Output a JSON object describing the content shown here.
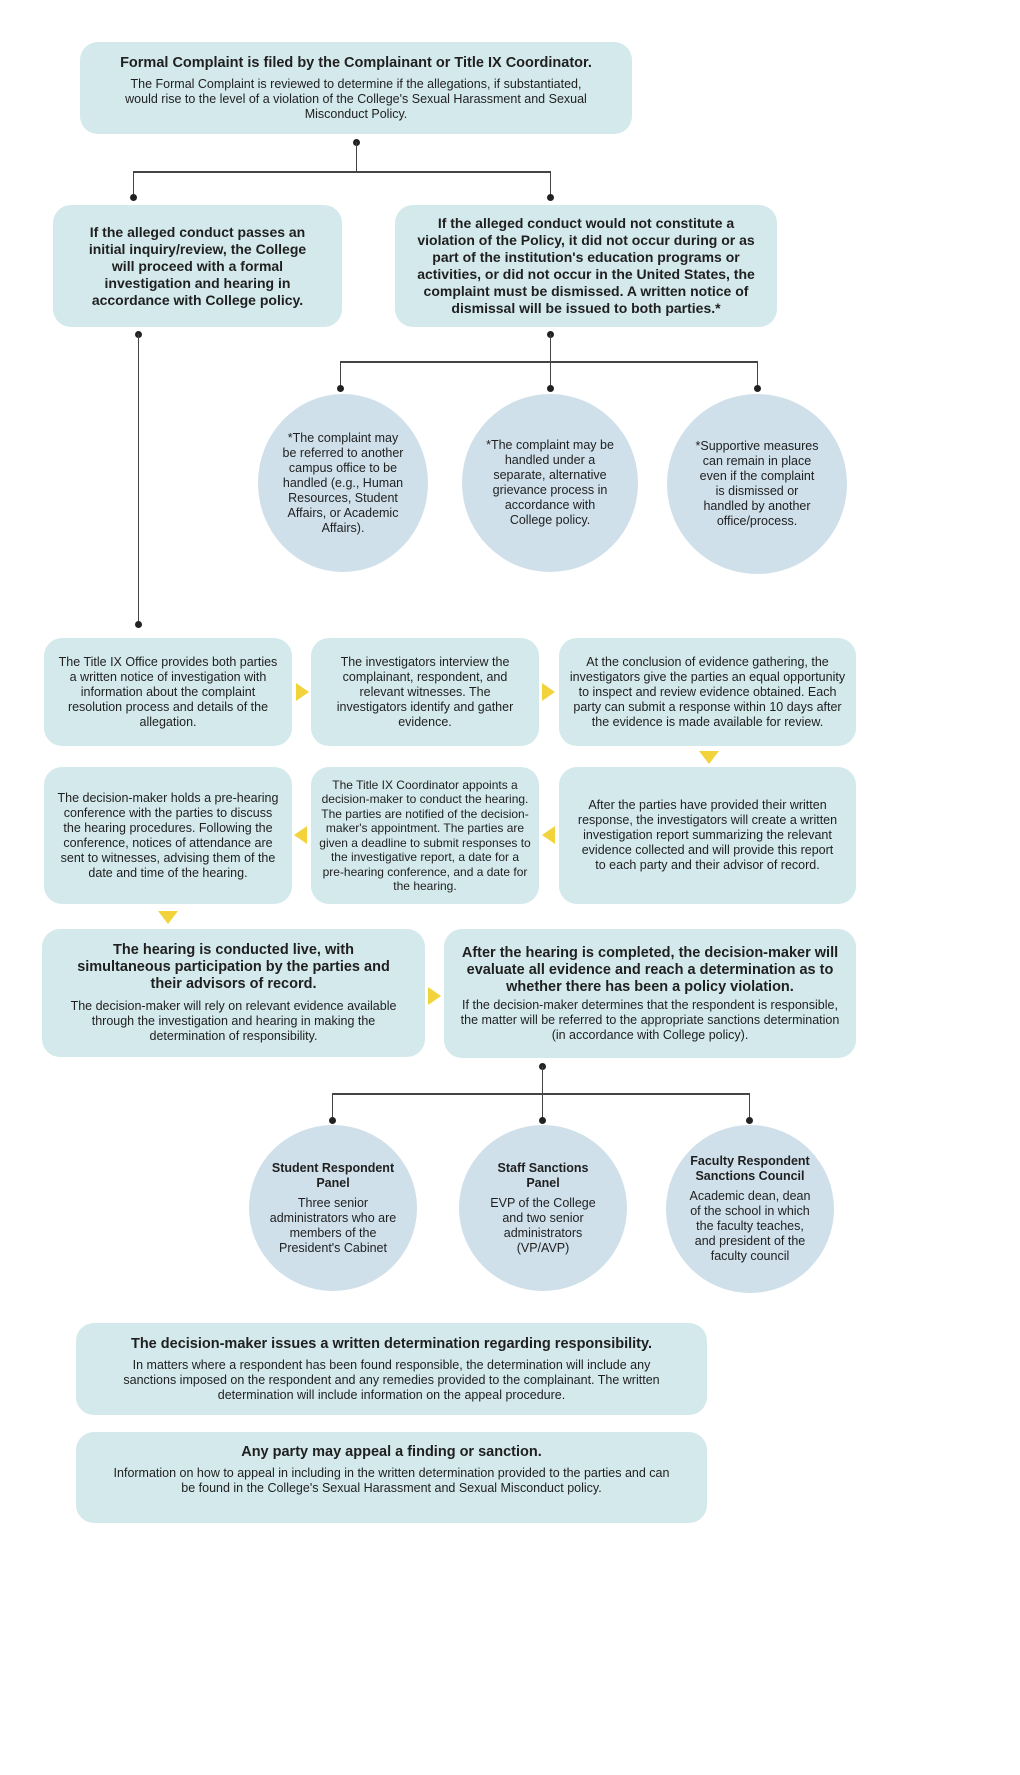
{
  "colors": {
    "box_fill": "#d4e9ec",
    "circle_fill": "#cfe0ea",
    "arrow": "#f2d33c",
    "connector": "#444444"
  },
  "formal_complaint": {
    "title": "Formal Complaint is filed by the Complainant or Title IX Coordinator.",
    "body": "The Formal Complaint is reviewed to determine if the allegations, if substantiated, would rise to the level of a violation of the College's Sexual Harassment and Sexual Misconduct Policy."
  },
  "branch_proceed": {
    "text": "If the alleged conduct passes an initial inquiry/review, the College will proceed with a formal investigation and hearing in accordance with College policy."
  },
  "branch_dismiss": {
    "text": "If the alleged conduct would not constitute a violation of the Policy, it did not occur during or as part of the institution's education programs or activities, or did not occur in the United States, the complaint must be dismissed. A written notice of dismissal will be issued to both parties.*"
  },
  "dismissal_notes": [
    {
      "text": "*The complaint may be referred to another campus office to be handled (e.g., Human Resources, Student Affairs, or Academic Affairs)."
    },
    {
      "text": "*The complaint may be handled under a separate, alternative grievance process in accordance with College policy."
    },
    {
      "text": "*Supportive measures can remain in place even if the complaint is dismissed or handled by another office/process."
    }
  ],
  "process_steps": [
    {
      "text": "The Title IX Office provides both parties a written notice of investigation with information about the complaint resolution process and details of the allegation."
    },
    {
      "text": "The investigators interview the complainant, respondent, and relevant witnesses. The investigators identify and gather evidence."
    },
    {
      "text": "At the conclusion of evidence gathering, the investigators give the parties an equal opportunity to inspect and review evidence obtained. Each party can submit a response within 10 days after the evidence is made available for review."
    },
    {
      "text": "After the parties have provided their written response, the investigators will create a written investigation report summarizing the relevant evidence collected and will provide this report to each party and their advisor of record."
    },
    {
      "text": "The Title IX Coordinator appoints a decision-maker to conduct the hearing. The parties are notified of the decision-maker's appointment. The parties are given a deadline to submit responses to the investigative report, a date for a pre-hearing conference, and a date for the hearing."
    },
    {
      "text": "The decision-maker holds a pre-hearing conference with the parties to discuss the hearing procedures. Following the conference, notices of attendance are sent to witnesses, advising them of the date and time of the hearing."
    }
  ],
  "hearing": {
    "title": "The hearing is conducted live, with simultaneous participation by the parties and their advisors of record.",
    "body": "The decision-maker will rely on relevant evidence available through the investigation and hearing in making the determination of responsibility."
  },
  "after_hearing": {
    "title": "After the hearing is completed, the decision-maker will evaluate all evidence and reach a determination as to whether there has been a policy violation.",
    "body": "If the decision-maker determines that the respondent is responsible, the matter will be referred to the appropriate sanctions determination (in accordance with College policy)."
  },
  "sanction_bodies": [
    {
      "title": "Student Respondent Panel",
      "body": "Three senior administrators who are members of the President's Cabinet"
    },
    {
      "title": "Staff Sanctions Panel",
      "body": "EVP of the College and two senior administrators (VP/AVP)"
    },
    {
      "title": "Faculty Respondent Sanctions Council",
      "body": "Academic dean, dean of the school in which the faculty teaches, and president of the faculty council"
    }
  ],
  "determination": {
    "title": "The decision-maker issues a written determination regarding responsibility.",
    "body": "In matters where a respondent has been found responsible, the determination will include any sanctions imposed on the respondent and any remedies provided to the complainant. The written determination will include information on the appeal procedure."
  },
  "appeal": {
    "title": "Any party may appeal a finding or sanction.",
    "body": "Information on how to appeal in including in the written determination provided to the parties and can be found in the College's Sexual Harassment and Sexual Misconduct policy."
  }
}
